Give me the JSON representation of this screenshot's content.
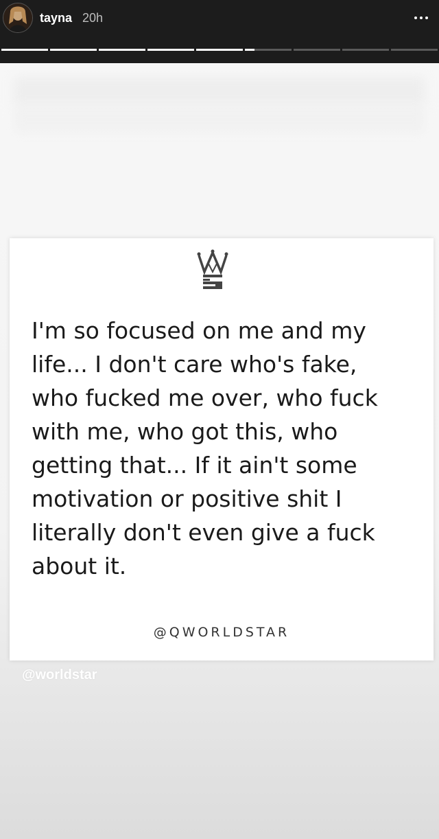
{
  "header": {
    "username": "tayna",
    "timestamp": "20h",
    "avatar_icon": "profile-photo",
    "menu_icon": "more-dots-icon"
  },
  "progress": {
    "segments": [
      1,
      1,
      1,
      1,
      1,
      0.2,
      0,
      0,
      0
    ],
    "segment_count": 9
  },
  "post": {
    "logo_icon": "worldstar-crown-logo",
    "quote_lines": [
      "I'm so focused on me and my",
      "life... I don't care who's fake,",
      "who fucked me over, who fuck",
      "with me, who got this, who",
      "getting that... If it ain't some",
      "motivation or positive shit I",
      "literally don't even give a fuck",
      "about it."
    ],
    "handle": "@QWORLDSTAR"
  },
  "watermark": "@worldstar",
  "colors": {
    "header_bg": "#1c1c1c",
    "progress_done": "#ffffff",
    "progress_pending": "#5a5a5a",
    "card_bg": "#ffffff"
  }
}
